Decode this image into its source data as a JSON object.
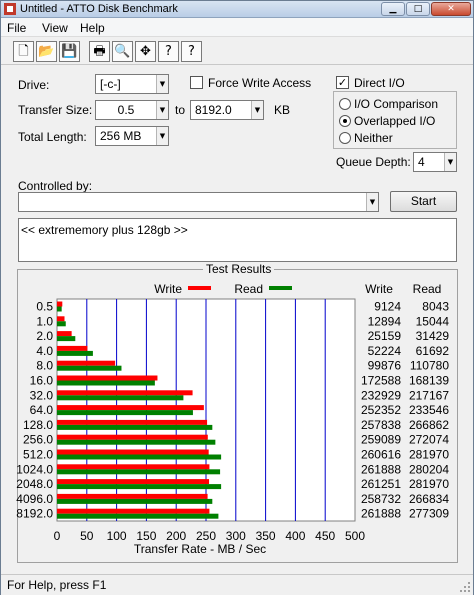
{
  "window": {
    "title": "Untitled - ATTO Disk Benchmark",
    "min_glyph": "▁",
    "max_glyph": "□",
    "close_glyph": "✕"
  },
  "menu": [
    "File",
    "View",
    "Help"
  ],
  "toolbar": {
    "icons": [
      "new-document-icon",
      "open-folder-icon",
      "save-icon",
      "print-icon",
      "print-preview-icon",
      "move-icon",
      "help-icon",
      "context-help-icon"
    ],
    "glyphs": [
      "🗋",
      "📂",
      "💾",
      "🖶",
      "🔍",
      "✥",
      "?",
      "?"
    ]
  },
  "settings": {
    "drive_label": "Drive:",
    "drive_value": "[-c-]",
    "force_write_access_label": "Force Write Access",
    "force_write_access_checked": false,
    "direct_io_label": "Direct I/O",
    "direct_io_checked": true,
    "transfer_size_label": "Transfer Size:",
    "transfer_min": "0.5",
    "to_label": "to",
    "transfer_max": "8192.0",
    "kb_label": "KB",
    "total_length_label": "Total Length:",
    "total_length_value": "256 MB",
    "io_mode_options": [
      "I/O Comparison",
      "Overlapped I/O",
      "Neither"
    ],
    "io_mode_selected": "Overlapped I/O",
    "queue_depth_label": "Queue Depth:",
    "queue_depth_value": "4",
    "controlled_by_label": "Controlled by:",
    "controlled_by_value": "",
    "start_label": "Start",
    "description": "<< extrememory plus 128gb >>"
  },
  "results": {
    "caption": "Test Results",
    "write_legend": "Write",
    "read_legend": "Read",
    "write_col": "Write",
    "read_col": "Read",
    "write_color": "#ff0000",
    "read_color": "#008000",
    "grid_color": "#0000cc"
  },
  "chart_data": {
    "type": "bar",
    "orientation": "horizontal",
    "categories": [
      "0.5",
      "1.0",
      "2.0",
      "4.0",
      "8.0",
      "16.0",
      "32.0",
      "64.0",
      "128.0",
      "256.0",
      "512.0",
      "1024.0",
      "2048.0",
      "4096.0",
      "8192.0"
    ],
    "series": [
      {
        "name": "Write",
        "values": [
          9124,
          12894,
          25159,
          52224,
          99876,
          172588,
          232929,
          252352,
          257838,
          259089,
          260616,
          261888,
          261251,
          258732,
          261888
        ]
      },
      {
        "name": "Read",
        "values": [
          8043,
          15044,
          31429,
          61692,
          110780,
          168139,
          217167,
          233546,
          266862,
          272074,
          281970,
          280204,
          281970,
          266834,
          277309
        ]
      }
    ],
    "write_display": [
      "9124",
      "12894",
      "25159",
      "52224",
      "99876",
      "172588",
      "232929",
      "252352",
      "257838",
      "259089",
      "260616",
      "261888",
      "261251",
      "258732",
      "261888"
    ],
    "read_display": [
      "8043",
      "15044",
      "31429",
      "61692",
      "110780",
      "168139",
      "217167",
      "233546",
      "266862",
      "272074",
      "281970",
      "280204",
      "281970",
      "266834",
      "277309"
    ],
    "xticks": [
      "0",
      "50",
      "100",
      "150",
      "200",
      "250",
      "300",
      "350",
      "400",
      "450",
      "500"
    ],
    "xlim": [
      0,
      500
    ],
    "xlabel": "Transfer Rate - MB / Sec",
    "grid": true,
    "legend": "top"
  },
  "statusbar": {
    "text": "For Help, press F1"
  }
}
